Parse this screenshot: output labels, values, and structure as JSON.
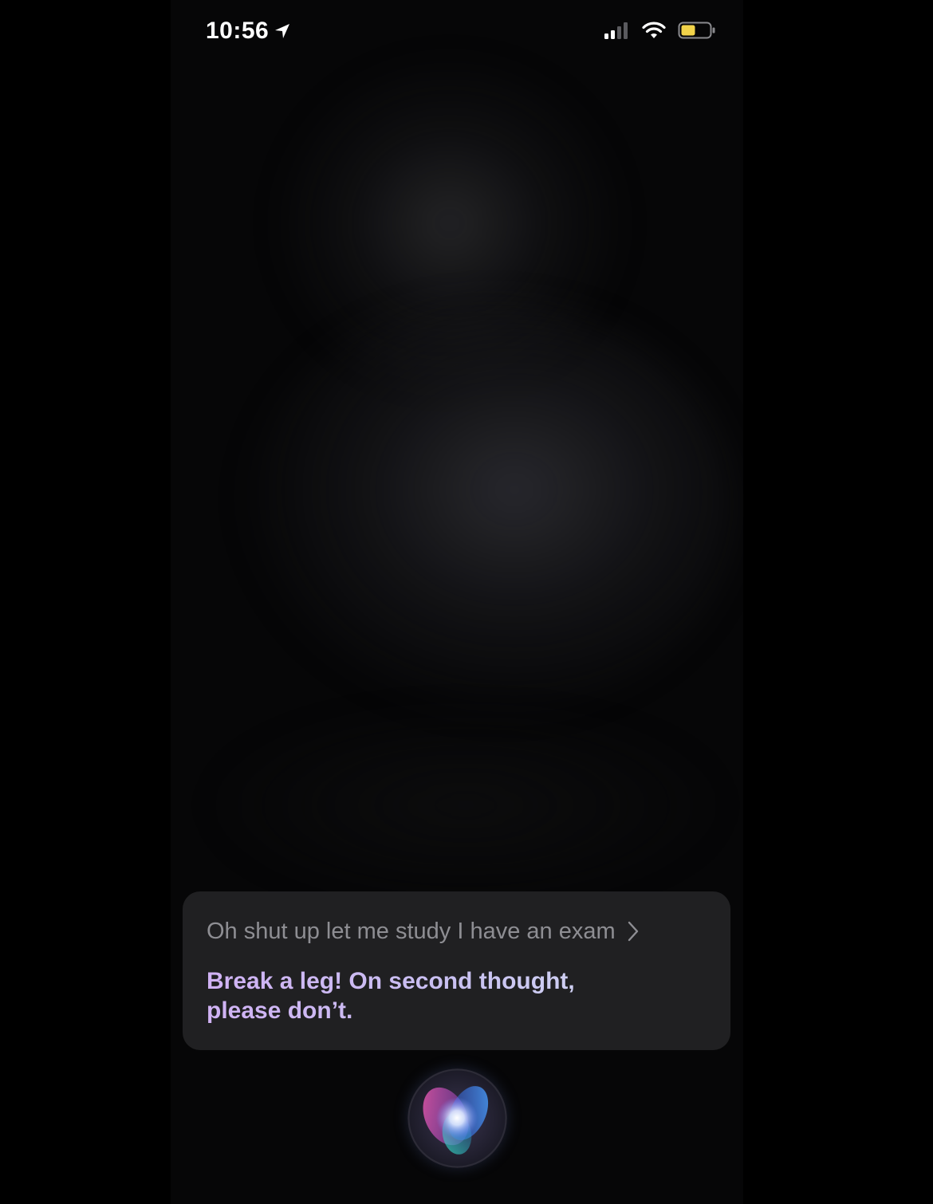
{
  "status_bar": {
    "time": "10:56",
    "location_icon": "location-arrow-icon",
    "signal_icon": "cellular-signal-icon",
    "wifi_icon": "wifi-icon",
    "battery_icon": "battery-icon",
    "battery_color": "#f2d34a"
  },
  "siri": {
    "query": "Oh shut up let me study I have an exam",
    "query_chevron_icon": "chevron-right-icon",
    "response_line1": "Break a leg! On second thought,",
    "response_line2": "please don’t.",
    "orb_icon": "siri-orb-icon"
  },
  "colors": {
    "background": "#000000",
    "card": "#202022",
    "query_text": "#8e8e93",
    "response_text": "#d3b6f5"
  }
}
